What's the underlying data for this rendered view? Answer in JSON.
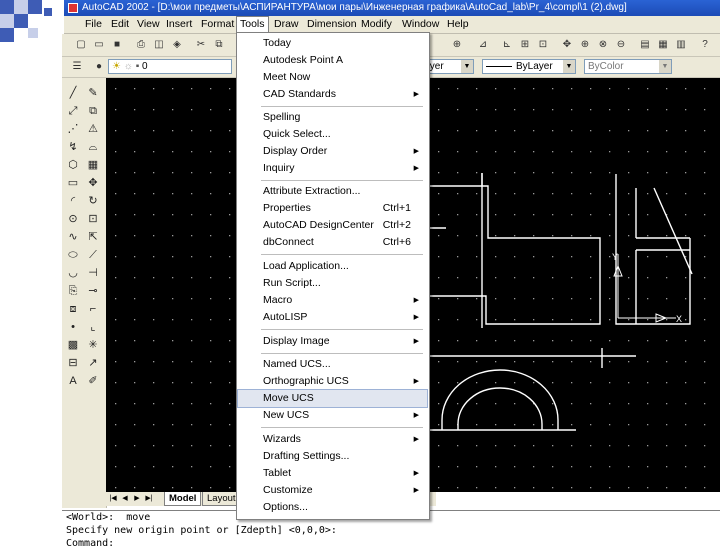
{
  "titlebar": {
    "title": "AutoCAD 2002 - [D:\\мои предметы\\АСПИРАНТУРА\\мои пары\\Инженерная графика\\AutoCad_lab\\Pr_4\\compl\\1 (2).dwg]"
  },
  "menubar": {
    "items": [
      "File",
      "Edit",
      "View",
      "Insert",
      "Format",
      "Tools",
      "Draw",
      "Dimension",
      "Modify",
      "Window",
      "Help"
    ],
    "active": "Tools"
  },
  "layers": {
    "layer_value": "0",
    "linetype_value": "ByLayer",
    "lineweight_value": "ByLayer",
    "color_value": "ByColor"
  },
  "tools_menu": {
    "items": [
      {
        "label": "Today",
        "shortcut": "",
        "submenu": false
      },
      {
        "label": "Autodesk Point A",
        "shortcut": "",
        "submenu": false
      },
      {
        "label": "Meet Now",
        "shortcut": "",
        "submenu": false
      },
      {
        "label": "CAD Standards",
        "shortcut": "",
        "submenu": true
      },
      {
        "label": "Spelling",
        "shortcut": "",
        "submenu": false
      },
      {
        "label": "Quick Select...",
        "shortcut": "",
        "submenu": false
      },
      {
        "label": "Display Order",
        "shortcut": "",
        "submenu": true
      },
      {
        "label": "Inquiry",
        "shortcut": "",
        "submenu": true
      },
      {
        "label": "Attribute Extraction...",
        "shortcut": "",
        "submenu": false
      },
      {
        "label": "Properties",
        "shortcut": "Ctrl+1",
        "submenu": false
      },
      {
        "label": "AutoCAD DesignCenter",
        "shortcut": "Ctrl+2",
        "submenu": false
      },
      {
        "label": "dbConnect",
        "shortcut": "Ctrl+6",
        "submenu": false
      },
      {
        "label": "Load Application...",
        "shortcut": "",
        "submenu": false
      },
      {
        "label": "Run Script...",
        "shortcut": "",
        "submenu": false
      },
      {
        "label": "Macro",
        "shortcut": "",
        "submenu": true
      },
      {
        "label": "AutoLISP",
        "shortcut": "",
        "submenu": true
      },
      {
        "label": "Display Image",
        "shortcut": "",
        "submenu": true
      },
      {
        "label": "Named UCS...",
        "shortcut": "",
        "submenu": false
      },
      {
        "label": "Orthographic UCS",
        "shortcut": "",
        "submenu": true
      },
      {
        "label": "Move UCS",
        "shortcut": "",
        "submenu": false
      },
      {
        "label": "New UCS",
        "shortcut": "",
        "submenu": true
      },
      {
        "label": "Wizards",
        "shortcut": "",
        "submenu": true
      },
      {
        "label": "Drafting Settings...",
        "shortcut": "",
        "submenu": false
      },
      {
        "label": "Tablet",
        "shortcut": "",
        "submenu": true
      },
      {
        "label": "Customize",
        "shortcut": "",
        "submenu": true
      },
      {
        "label": "Options...",
        "shortcut": "",
        "submenu": false
      }
    ],
    "highlighted": "Move UCS"
  },
  "layout_tabs": {
    "model": "Model",
    "layout": "Layout"
  },
  "canvas_labels": {
    "y_axis": "Y",
    "x_axis": "X"
  },
  "command_line": {
    "line1": "<World>:  move",
    "line2": "Specify new origin point or [Zdepth] <0,0,0>:",
    "line3": "Command:"
  },
  "colors": {
    "canvas_bg": "#000000",
    "menu_highlight": "#e1e6f0",
    "titlebar": "#2a63d4",
    "deco_blue": "#3e5cb5"
  }
}
